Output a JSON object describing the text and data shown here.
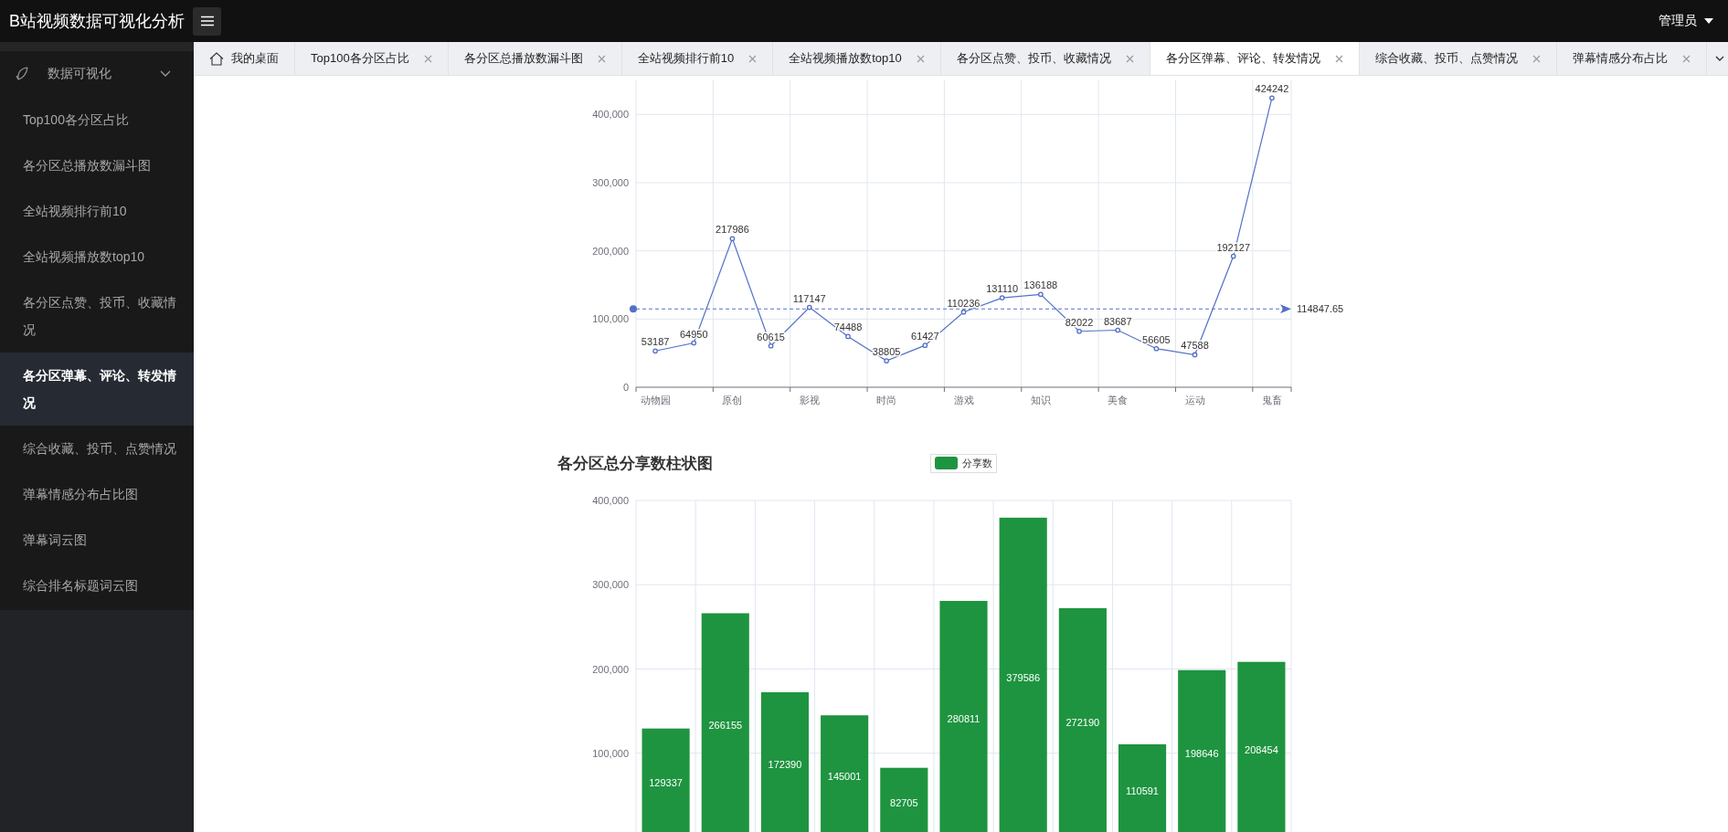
{
  "header": {
    "title": "B站视频数据可视化分析",
    "user": "管理员"
  },
  "sidebar": {
    "group": {
      "label": "数据可视化",
      "expanded": true
    },
    "items": [
      {
        "label": "Top100各分区占比",
        "selected": false
      },
      {
        "label": "各分区总播放数漏斗图",
        "selected": false
      },
      {
        "label": "全站视频排行前10",
        "selected": false
      },
      {
        "label": "全站视频播放数top10",
        "selected": false
      },
      {
        "label": "各分区点赞、投币、收藏情况",
        "selected": false
      },
      {
        "label": "各分区弹幕、评论、转发情况",
        "selected": true
      },
      {
        "label": "综合收藏、投币、点赞情况",
        "selected": false
      },
      {
        "label": "弹幕情感分布占比图",
        "selected": false
      },
      {
        "label": "弹幕词云图",
        "selected": false
      },
      {
        "label": "综合排名标题词云图",
        "selected": false
      }
    ]
  },
  "tabs": [
    {
      "kind": "home",
      "label": "我的桌面",
      "selected": false
    },
    {
      "kind": "page",
      "label": "Top100各分区占比",
      "selected": false
    },
    {
      "kind": "page",
      "label": "各分区总播放数漏斗图",
      "selected": false
    },
    {
      "kind": "page",
      "label": "全站视频排行前10",
      "selected": false
    },
    {
      "kind": "page",
      "label": "全站视频播放数top10",
      "selected": false
    },
    {
      "kind": "page",
      "label": "各分区点赞、投币、收藏情况",
      "selected": false
    },
    {
      "kind": "page",
      "label": "各分区弹幕、评论、转发情况",
      "selected": true
    },
    {
      "kind": "page",
      "label": "综合收藏、投币、点赞情况",
      "selected": false
    },
    {
      "kind": "page",
      "label": "弹幕情感分布占比",
      "selected": false
    }
  ],
  "line_chart": {
    "chart_data": {
      "type": "line",
      "categories": [
        "动物园",
        null,
        "原创",
        null,
        "影视",
        null,
        "时尚",
        null,
        "游戏",
        null,
        "知识",
        null,
        "美食",
        null,
        "运动",
        null,
        "鬼畜"
      ],
      "grid": true,
      "series": [
        {
          "color": "#5470c6",
          "marker": "circle",
          "values": [
            53187,
            64950,
            217986,
            60615,
            117147,
            74488,
            38805,
            61427,
            110236,
            131110,
            136188,
            82022,
            83687,
            56605,
            47588,
            192127,
            424242
          ]
        }
      ],
      "ylim": [
        0,
        450000
      ],
      "yticks": [
        0,
        {
          "value": 100000,
          "label": "100,000"
        },
        {
          "value": 200000,
          "label": "200,000"
        },
        {
          "value": 300000,
          "label": "300,000"
        },
        {
          "value": 400000,
          "label": "400,000"
        }
      ],
      "data_labels": true,
      "ref_lines": [
        {
          "axis": "y",
          "value": 114847.65,
          "label": "114847.65"
        }
      ]
    }
  },
  "bar_chart": {
    "chart_data": {
      "type": "bar",
      "title": "各分区总分享数柱状图",
      "grid": true,
      "series": [
        {
          "name": "分享数",
          "color": "#1e9440",
          "values": [
            129337,
            266155,
            172390,
            145001,
            82705,
            280811,
            379586,
            272190,
            110591,
            198646,
            208454
          ]
        }
      ],
      "ylim": [
        0,
        400000
      ],
      "yticks": [
        {
          "value": 100000,
          "label": "100,000"
        },
        {
          "value": 200000,
          "label": "200,000"
        },
        {
          "value": 300000,
          "label": "300,000"
        },
        {
          "value": 400000,
          "label": "400,000"
        }
      ],
      "data_labels": true
    }
  }
}
